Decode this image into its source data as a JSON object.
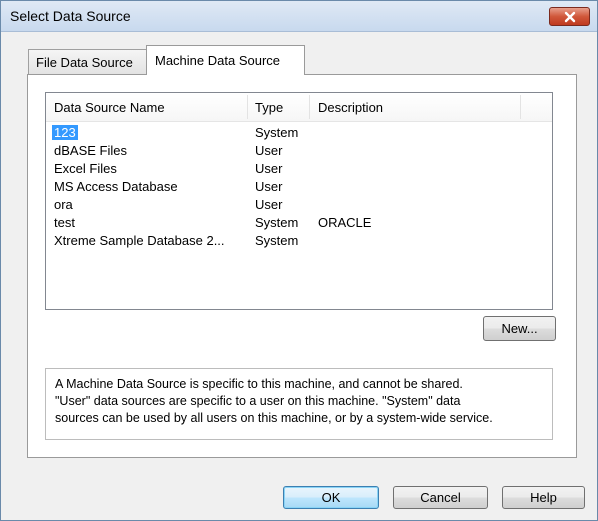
{
  "window": {
    "title": "Select Data Source"
  },
  "tabs": [
    {
      "label": "File Data Source"
    },
    {
      "label": "Machine Data Source"
    }
  ],
  "list": {
    "columns": [
      "Data Source Name",
      "Type",
      "Description"
    ],
    "rows": [
      {
        "name": "123",
        "type": "System",
        "description": ""
      },
      {
        "name": "dBASE Files",
        "type": "User",
        "description": ""
      },
      {
        "name": "Excel Files",
        "type": "User",
        "description": ""
      },
      {
        "name": "MS Access Database",
        "type": "User",
        "description": ""
      },
      {
        "name": "ora",
        "type": "User",
        "description": ""
      },
      {
        "name": "test",
        "type": "System",
        "description": "ORACLE"
      },
      {
        "name": "Xtreme Sample Database 2...",
        "type": "System",
        "description": ""
      }
    ],
    "selected_index": 0
  },
  "buttons": {
    "new": "New...",
    "ok": "OK",
    "cancel": "Cancel",
    "help": "Help"
  },
  "description_lines": [
    "A Machine Data Source is specific to this machine, and cannot be shared.",
    "\"User\" data sources are specific to a user on this machine.  \"System\" data",
    "sources can be used by all users on this machine, or by a system-wide service."
  ],
  "colors": {
    "selection": "#3399ff",
    "close_button": "#c7452a",
    "default_button_border": "#3c7fb1"
  },
  "icons": {
    "close": "close-icon"
  }
}
